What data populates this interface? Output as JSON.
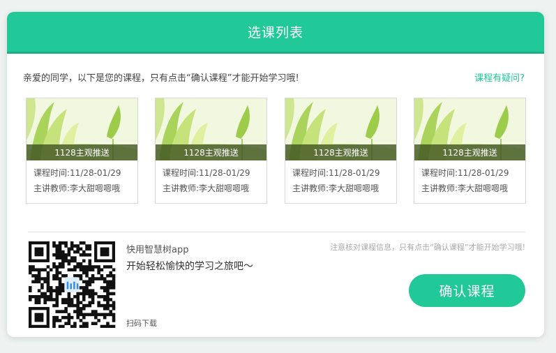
{
  "modal": {
    "title": "选课列表",
    "intro": "亲爱的同学，以下是您的课程，只有点击“确认课程”才能开始学习哦!",
    "help_link": "课程有疑问?"
  },
  "courses": [
    {
      "name": "1128主观推送",
      "time": "课程时间:11/28-01/29",
      "teacher": "主讲教师:李大甜嗯嗯哦"
    },
    {
      "name": "1128主观推送",
      "time": "课程时间:11/28-01/29",
      "teacher": "主讲教师:李大甜嗯嗯哦"
    },
    {
      "name": "1128主观推送",
      "time": "课程时间:11/28-01/29",
      "teacher": "主讲教师:李大甜嗯嗯哦"
    },
    {
      "name": "1128主观推送",
      "time": "课程时间:11/28-01/29",
      "teacher": "主讲教师:李大甜嗯嗯哦"
    }
  ],
  "footer": {
    "app_name": "快用智慧树app",
    "slogan": "开始轻松愉快的学习之旅吧〜",
    "scan_text": "扫码下载",
    "notice": "注意核对课程信息，只有点击“确认课程”才能开始学习哦!",
    "confirm_label": "确认课程"
  },
  "colors": {
    "accent": "#20c997",
    "card_bar": "#3c501e"
  }
}
